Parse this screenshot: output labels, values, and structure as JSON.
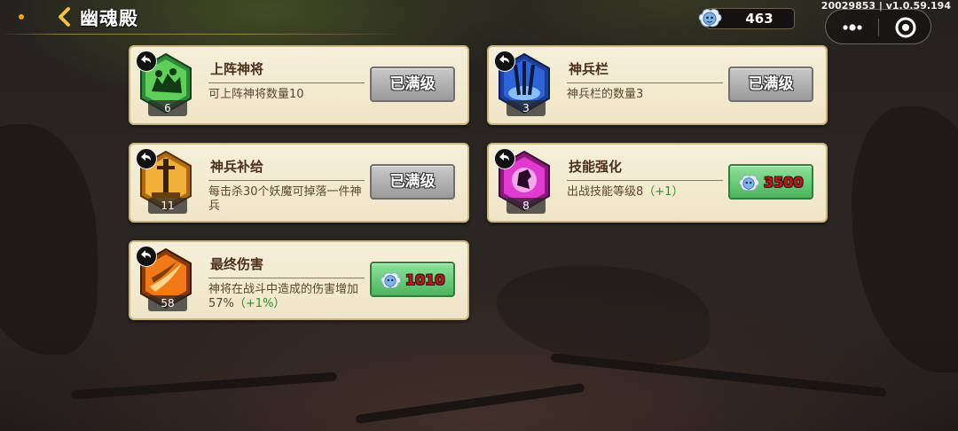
{
  "header": {
    "title": "幽魂殿",
    "currency_value": "463",
    "version": "20029853 | v1.0.59.194"
  },
  "colors": {
    "card_bg": "#f3ead1",
    "card_border": "#c9b47e",
    "maxed_button": "#a9a9a9",
    "buy_button": "#5cc36b",
    "price_text": "#c01818",
    "bonus_text": "#2f8a2a"
  },
  "cards": [
    {
      "name": "上阵神将",
      "desc": "可上阵神将数量10",
      "bonus": "",
      "level": "6",
      "icon": "warriors-icon",
      "action": "maxed",
      "button_label": "已满级"
    },
    {
      "name": "神兵栏",
      "desc": "神兵栏的数量3",
      "bonus": "",
      "level": "3",
      "icon": "swords-icon",
      "action": "maxed",
      "button_label": "已满级"
    },
    {
      "name": "神兵补给",
      "desc": "每击杀30个妖魔可掉落一件神兵",
      "bonus": "",
      "level": "11",
      "icon": "sword-altar-icon",
      "action": "maxed",
      "button_label": "已满级"
    },
    {
      "name": "技能强化",
      "desc": "出战技能等级8",
      "bonus": "（+1）",
      "level": "8",
      "icon": "skill-fist-icon",
      "action": "buy",
      "price": "3500"
    },
    {
      "name": "最终伤害",
      "desc": "神将在战斗中造成的伤害增加57%",
      "bonus": "（+1%）",
      "level": "58",
      "icon": "fire-slash-icon",
      "action": "buy",
      "price": "1010"
    }
  ]
}
